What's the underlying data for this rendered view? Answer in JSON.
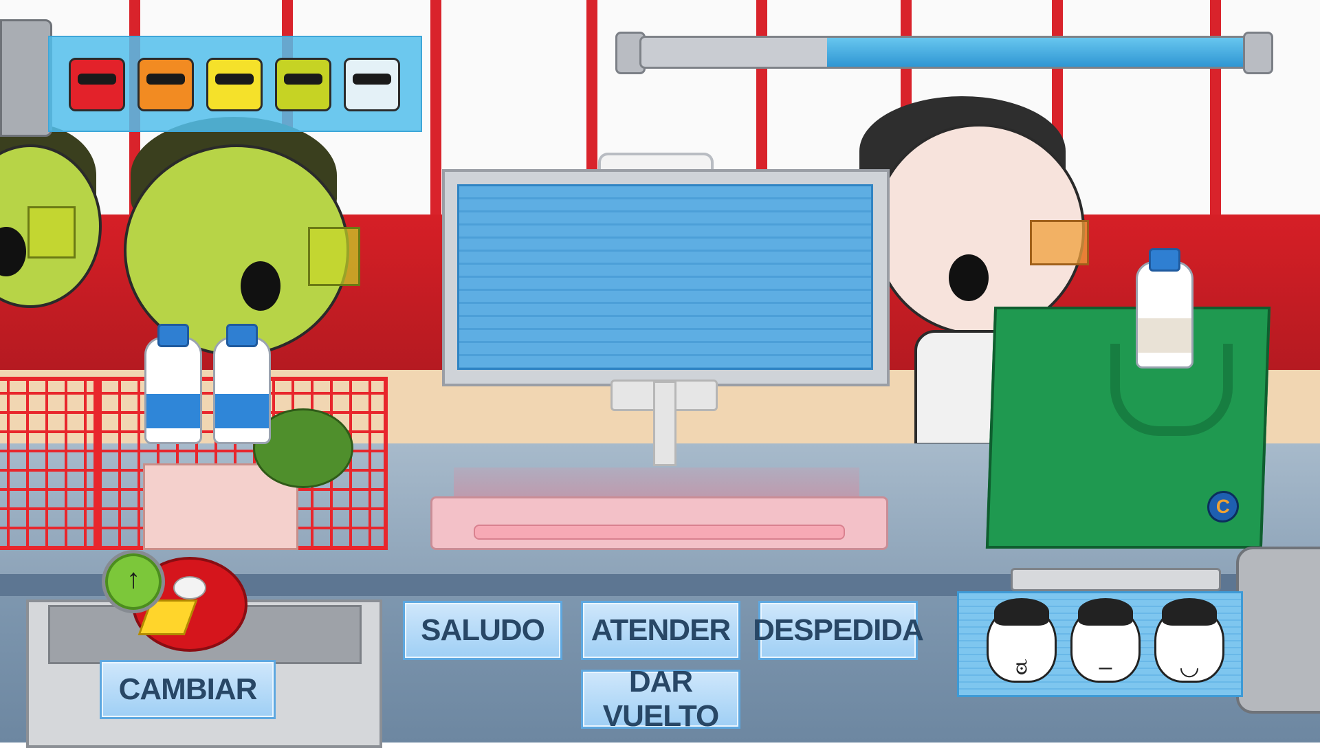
{
  "game": {
    "progress_percent": 30,
    "colors": {
      "tube_fill": "#2f96d3",
      "button_text": "#284766",
      "basket": "#e8262c",
      "bag": "#1f9950"
    }
  },
  "queue_moods": [
    {
      "name": "angry-red-face-icon",
      "color": "#e3222a"
    },
    {
      "name": "annoyed-orange-face-icon",
      "color": "#f28b22"
    },
    {
      "name": "neutral-yellow-face-icon",
      "color": "#f5e12a"
    },
    {
      "name": "happy-lime-face-icon",
      "color": "#c6d324"
    },
    {
      "name": "happy-white-face-icon",
      "color": "#e4f1f7"
    }
  ],
  "actions": {
    "saludo": "SALUDO",
    "atender": "ATENDER",
    "despedida": "DESPEDIDA",
    "dar_vuelto": "DAR VUELTO",
    "cambiar": "CAMBIAR"
  },
  "icons": {
    "timer_arrow": "↑",
    "bag_logo": "C",
    "portrait_angry": "ಠ",
    "portrait_neutral": "–",
    "portrait_happy": "◡"
  }
}
